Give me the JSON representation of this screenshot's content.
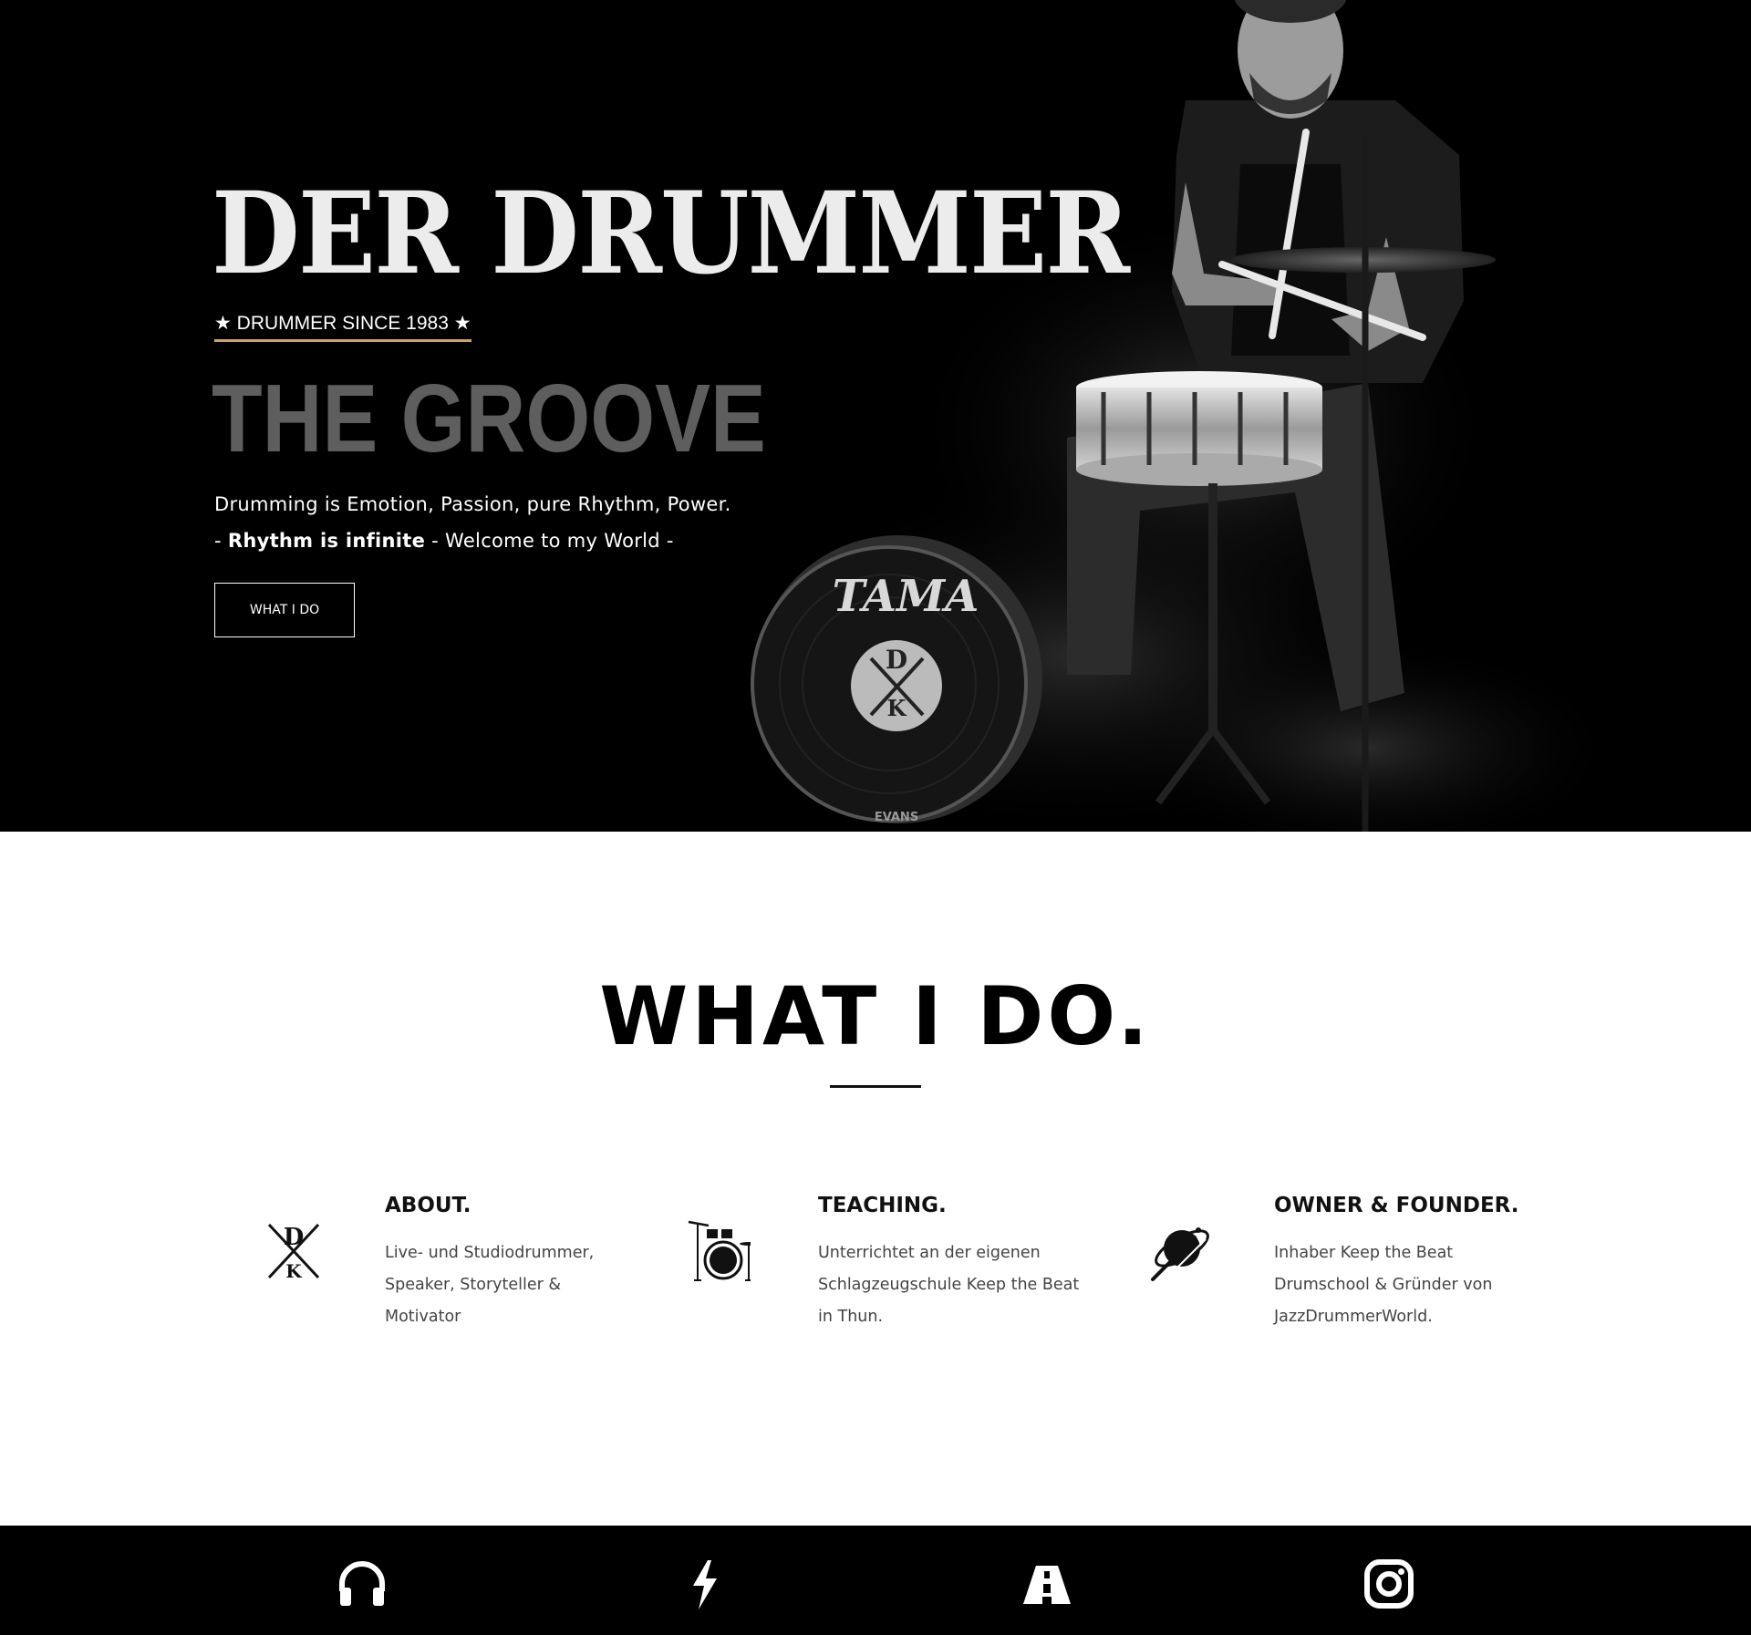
{
  "hero": {
    "brand": "DER DRUMMER",
    "since": "★ DRUMMER SINCE 1983 ★",
    "headline": "THE GROOVE",
    "tagline_line1": "Drumming is Emotion, Passion, pure Rhythm, Power.",
    "tagline_prefix": "- ",
    "tagline_bold": "Rhythm is infinite",
    "tagline_suffix": " - Welcome to my World -",
    "button_label": "WHAT I DO",
    "drum_brand": "TAMA",
    "drumhead_brand": "EVANS",
    "accent_color": "#c8a56b"
  },
  "what_i_do": {
    "title": "WHAT I DO.",
    "cards": [
      {
        "icon": "logo-dk-icon",
        "title": "ABOUT.",
        "lines": [
          "Live- und Studiodrummer,",
          "Speaker, Storyteller &",
          "Motivator"
        ]
      },
      {
        "icon": "drum-kit-icon",
        "title": "TEACHING.",
        "lines": [
          "Unterrichtet an der eigenen",
          "Schlagzeugschule Keep the Beat",
          "in Thun."
        ]
      },
      {
        "icon": "planet-drumsticks-icon",
        "title": "OWNER & FOUNDER.",
        "lines": [
          "Inhaber Keep the Beat",
          "Drumschool & Gründer von",
          "JazzDrummerWorld."
        ]
      }
    ]
  },
  "footer": {
    "icons": [
      "headphones-icon",
      "lightning-icon",
      "road-icon",
      "instagram-icon"
    ]
  }
}
